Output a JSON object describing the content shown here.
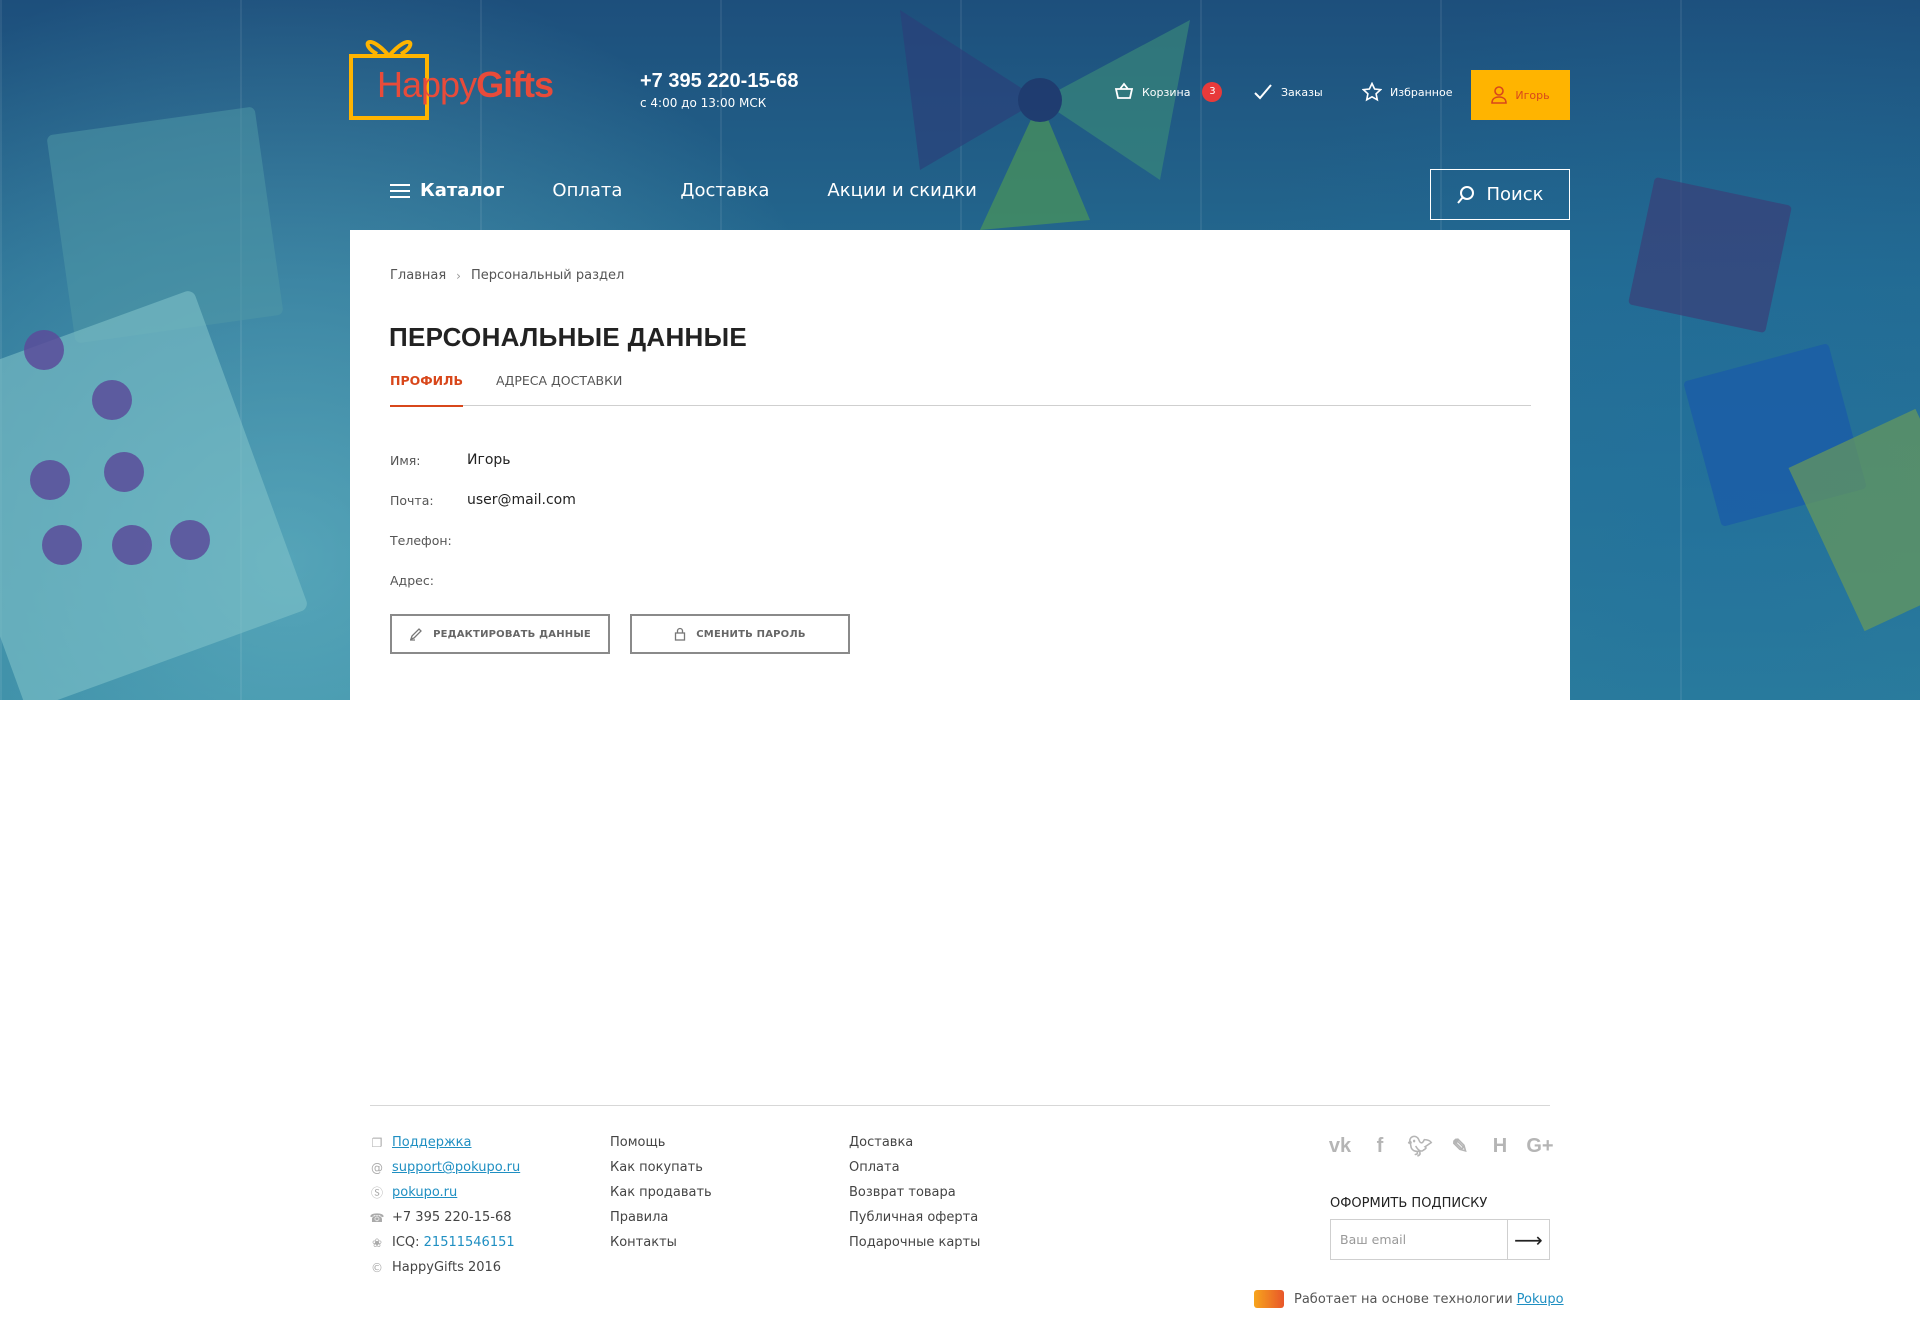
{
  "header": {
    "logo_part1": "Happy",
    "logo_part2": "Gifts",
    "phone": "+7 395 220-15-68",
    "hours": "с 4:00 до 13:00 МСК",
    "cart_label": "Корзина",
    "cart_count": "3",
    "orders_label": "Заказы",
    "favorites_label": "Избранное",
    "user_label": "Игорь"
  },
  "nav": {
    "catalog": "Каталог",
    "payment": "Оплата",
    "delivery": "Доставка",
    "promos": "Акции и скидки",
    "search": "Поиск"
  },
  "breadcrumb": {
    "home": "Главная",
    "current": "Персональный раздел"
  },
  "page": {
    "title": "ПЕРСОНАЛЬНЫЕ ДАННЫЕ",
    "tabs": [
      {
        "label": "ПРОФИЛЬ",
        "active": true
      },
      {
        "label": "АДРЕСА ДОСТАВКИ",
        "active": false
      }
    ],
    "fields": [
      {
        "label": "Имя:",
        "value": "Игорь"
      },
      {
        "label": "Почта:",
        "value": "user@mail.com"
      },
      {
        "label": "Телефон:",
        "value": ""
      },
      {
        "label": "Адрес:",
        "value": ""
      }
    ],
    "edit_button": "РЕДАКТИРОВАТЬ ДАННЫЕ",
    "password_button": "СМЕНИТЬ ПАРОЛЬ"
  },
  "footer": {
    "contacts": [
      {
        "icon": "support-icon",
        "text": "Поддержка",
        "link": true
      },
      {
        "icon": "email-icon",
        "text": "support@pokupo.ru",
        "link": true
      },
      {
        "icon": "skype-icon",
        "text": "pokupo.ru",
        "link": true
      },
      {
        "icon": "phone-icon",
        "text": "+7 395 220-15-68",
        "link": false
      },
      {
        "icon": "icq-icon",
        "text": "ICQ: ",
        "link_text": "21511546151"
      },
      {
        "icon": "copyright-icon",
        "text": "HappyGifts 2016",
        "link": false
      }
    ],
    "col2": [
      "Помощь",
      "Как покупать",
      "Как продавать",
      "Правила",
      "Контакты"
    ],
    "col3": [
      "Доставка",
      "Оплата",
      "Возврат товара",
      "Публичная оферта",
      "Подарочные карты"
    ],
    "socials": [
      "vk-icon",
      "facebook-icon",
      "twitter-icon",
      "feather-icon",
      "habr-icon",
      "google-plus-icon"
    ],
    "subscribe_title": "ОФОРМИТЬ ПОДПИСКУ",
    "email_placeholder": "Ваш email",
    "powered_text": "Работает на основе технологии",
    "powered_link": "Pokupo"
  },
  "colors": {
    "accent_yellow": "#ffb400",
    "accent_red": "#d8471b",
    "link_blue": "#1f8fc2",
    "badge_red": "#e83a3a"
  }
}
